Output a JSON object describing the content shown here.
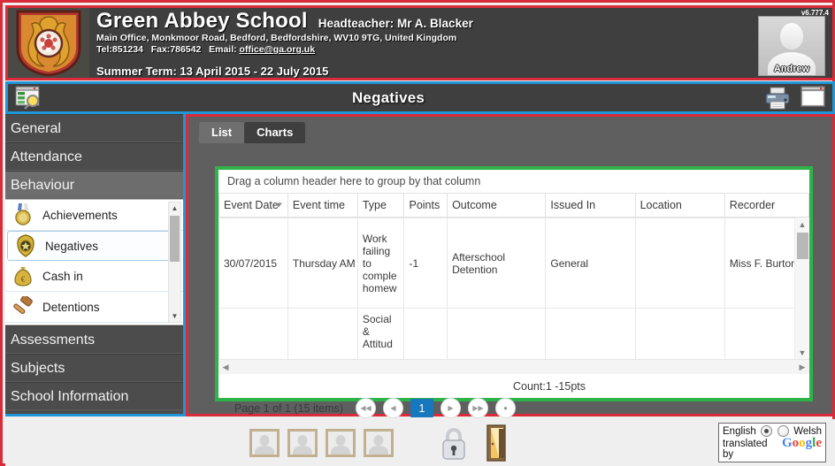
{
  "header": {
    "school_name": "Green Abbey School",
    "headteacher": "Headteacher: Mr A. Blacker",
    "address": "Main Office, Monkmoor Road, Bedford, Bedfordshire, WV10 9TG, United Kingdom",
    "tel_label": "Tel:851234",
    "fax_label": "Fax:786542",
    "email_label": "Email:",
    "email": "office@ga.org.uk",
    "term": "Summer Term: 13 April 2015 - 22 July 2015",
    "version": "v6.777.4",
    "user_name": "Andrew"
  },
  "titlebar": {
    "title": "Negatives",
    "left_icon": "window-search-icon",
    "print_icon": "printer-icon",
    "screen_icon": "monitor-icon"
  },
  "sidebar": {
    "items": [
      {
        "label": "General",
        "active": false
      },
      {
        "label": "Attendance",
        "active": false
      },
      {
        "label": "Behaviour",
        "active": true
      }
    ],
    "sub_items": [
      {
        "label": "Achievements",
        "icon": "medal-icon",
        "selected": false
      },
      {
        "label": "Negatives",
        "icon": "badge-icon",
        "selected": true
      },
      {
        "label": "Cash in",
        "icon": "money-bag-icon",
        "selected": false
      },
      {
        "label": "Detentions",
        "icon": "gavel-icon",
        "selected": false
      }
    ],
    "items_after": [
      {
        "label": "Assessments",
        "active": false
      },
      {
        "label": "Subjects",
        "active": false
      },
      {
        "label": "School Information",
        "active": false
      }
    ]
  },
  "content": {
    "tabs": [
      {
        "label": "List",
        "active": false
      },
      {
        "label": "Charts",
        "active": true
      }
    ],
    "group_hint": "Drag a column header here to group by that column",
    "columns": [
      "Event Date",
      "Event time",
      "Type",
      "Points",
      "Outcome",
      "Issued In",
      "Location",
      "Recorder"
    ],
    "rows": [
      {
        "event_date": "30/07/2015",
        "event_time": "Thursday AM",
        "type": "Work failing to comple homew",
        "points": "-1",
        "outcome": "Afterschool Detention",
        "issued_in": "General",
        "location": "",
        "recorder": "Miss F. Burton"
      },
      {
        "event_date": "",
        "event_time": "",
        "type": "Social & Attitud",
        "points": "",
        "outcome": "",
        "issued_in": "",
        "location": "",
        "recorder": ""
      }
    ],
    "count_text": "Count:1  -15pts",
    "page_text": "Page 1 of 1 (15 items)",
    "current_page": "1"
  },
  "footer": {
    "photos_count": 4,
    "lock_icon": "padlock-icon",
    "exit_icon": "exit-door-icon",
    "language": {
      "left_label": "English",
      "right_label": "Welsh",
      "selected": "English",
      "translated_by": "translated by",
      "brand": [
        "G",
        "o",
        "o",
        "g",
        "l",
        "e"
      ]
    }
  },
  "colors": {
    "frame_red": "#d92b3a",
    "title_blue": "#2196d6",
    "grid_green": "#2db34a",
    "page_blue": "#1878be"
  }
}
